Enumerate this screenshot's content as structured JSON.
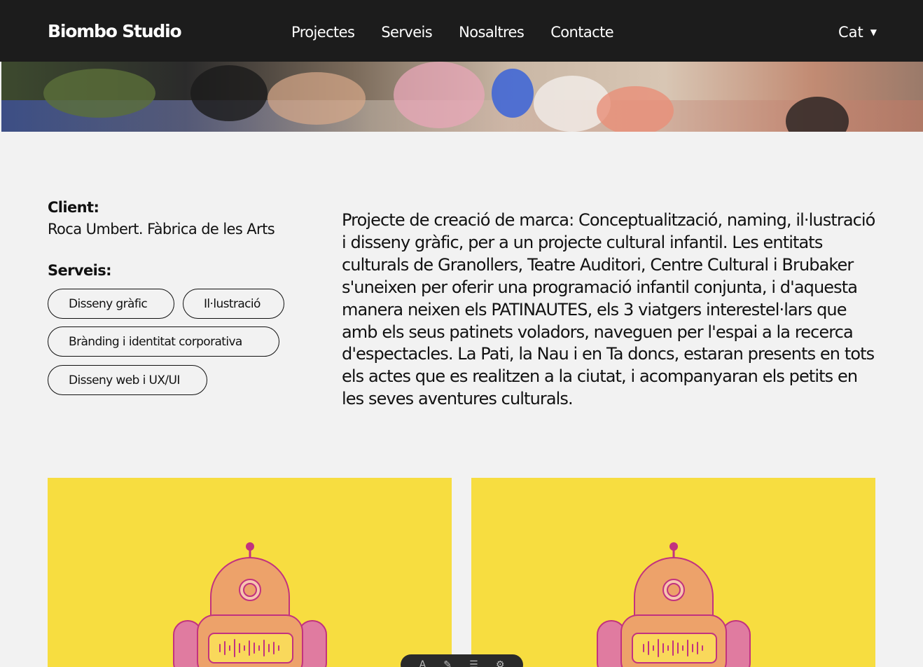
{
  "nav": {
    "brand": "Biombo Studio",
    "links": [
      "Projectes",
      "Serveis",
      "Nosaltres",
      "Contacte"
    ],
    "language": "Cat",
    "language_caret": "▼"
  },
  "project": {
    "client_label": "Client:",
    "client_value": "Roca Umbert. Fàbrica de les Arts",
    "services_label": "Serveis:",
    "services": [
      "Disseny gràfic",
      "Il·lustració",
      "Brànding i identitat corporativa",
      "Disseny web i UX/UI"
    ],
    "description": "Projecte de creació de marca: Conceptualització, naming, il·lustració i disseny gràfic, per a un projecte cultural infantil. Les entitats culturals de Granollers, Teatre Auditori, Centre Cultural i Brubaker s'uneixen per oferir una programació infantil conjunta, i d'aquesta manera neixen els PATINAUTES, els 3 viatgers interestel·lars que amb els seus patinets voladors, naveguen per l'espai a la recerca d'espectacles. La Pati, la Nau i en Ta doncs, estaran presents en tots els actes que es realitzen a la ciutat, i acompanyaran els petits en les seves aventures culturals."
  },
  "colors": {
    "navbar": "#1c1c1c",
    "card_background": "#f7dd40",
    "robot_orange": "#eda26a",
    "robot_pink": "#e07ba0",
    "robot_outline": "#c2327f"
  },
  "toolbar": {
    "icons": [
      "text-icon",
      "pen-icon",
      "menu-icon",
      "gear-icon"
    ]
  }
}
